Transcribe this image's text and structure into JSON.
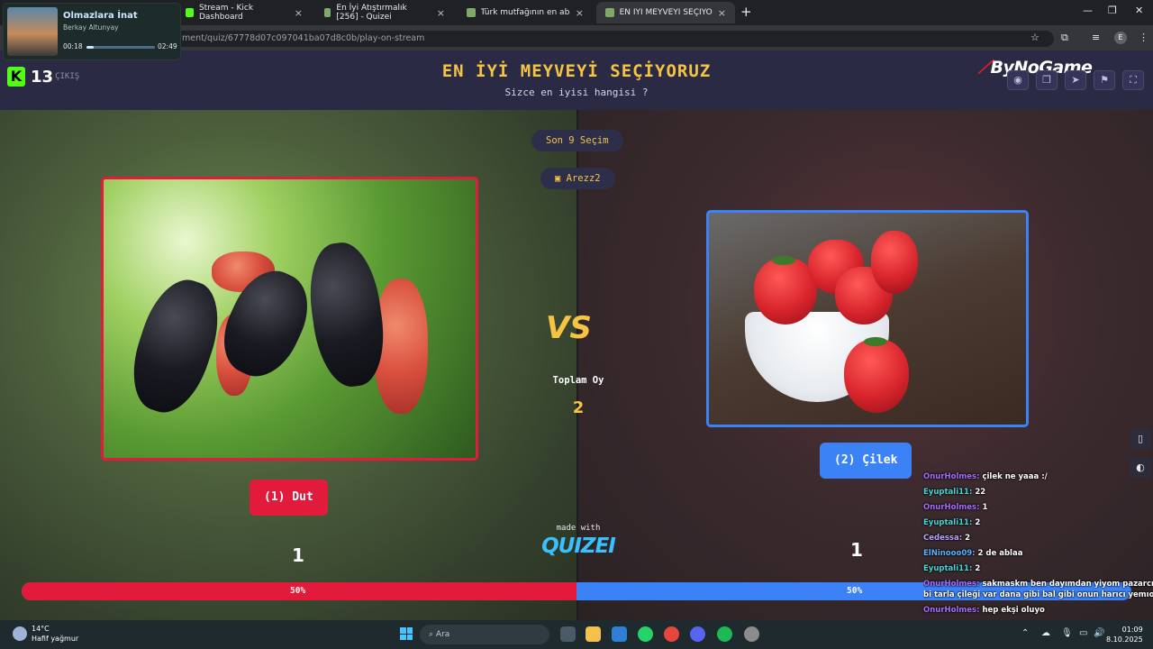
{
  "browser": {
    "tabs": [
      {
        "title": "Stream - Kick Dashboard"
      },
      {
        "title": "En İyi Atıştırmalık [256] - Quizei"
      },
      {
        "title": "Türk mutfağının en abartılmış t"
      },
      {
        "title": "EN İYİ MEYVEYİ SEÇİYORUZ - Q"
      }
    ],
    "url": "ment/quiz/67778d07c097041ba07d8c0b/play-on-stream",
    "profile_initial": "E"
  },
  "music": {
    "title": "Olmazlara İnat",
    "artist": "Berkay Altunyay",
    "elapsed": "00:18",
    "duration": "02:49",
    "progress": 0.1
  },
  "quiz": {
    "title": "EN İYİ MEYVEYİ SEÇİYORUZ",
    "subtitle": "Sizce en iyisi hangisi ?",
    "remaining": "Son 9 Seçim",
    "player": "Arezz2",
    "vs": "VS",
    "total_label": "Toplam Oy",
    "total_value": "2",
    "left": {
      "label": "(1) Dut",
      "votes": "1",
      "percent": "50%"
    },
    "right": {
      "label": "(2) Çilek",
      "votes": "1",
      "percent": "50%"
    },
    "progress_left_fraction": 0.5,
    "made_with": "made with",
    "quizei": "QUIZEI",
    "colors": {
      "left": "#e21b3c",
      "right": "#3b82f6",
      "accent": "#f5c542"
    }
  },
  "kick": {
    "logo": "K",
    "viewers": "13",
    "exit_label": "ÇIKIŞ"
  },
  "brand": {
    "logo": "ByNoGame"
  },
  "tools": [
    "eye-icon",
    "copy-icon",
    "send-icon",
    "flag-icon",
    "fullscreen-icon"
  ],
  "chat": [
    {
      "user": "OnurHolmes:",
      "text": "çilek ne yaaa :/",
      "color": "onur"
    },
    {
      "user": "Eyuptali11:",
      "text": "22",
      "color": "eyup"
    },
    {
      "user": "OnurHolmes:",
      "text": "1",
      "color": "onur"
    },
    {
      "user": "Eyuptali11:",
      "text": "2",
      "color": "eyup"
    },
    {
      "user": "Cedessa:",
      "text": "2",
      "color": "ced"
    },
    {
      "user": "ElNinooo09:",
      "text": "2 de ablaa",
      "color": "eli"
    },
    {
      "user": "Eyuptali11:",
      "text": "2",
      "color": "eyup"
    },
    {
      "user": "OnurHolmes:",
      "text": "sakmaskm ben dayımdan yiyom pazarcı dayım",
      "color": "onur"
    },
    {
      "user": "",
      "text": "bi tarla çileği var dana gibi bal gibi onun harıcı yemıom",
      "color": "onur"
    },
    {
      "user": "OnurHolmes:",
      "text": "hep ekşi oluyo",
      "color": "onur"
    },
    {
      "user": "Eyuptali11:",
      "text": "2",
      "color": "eyup"
    },
    {
      "user": "OnurHolmes:",
      "text": "1",
      "color": "onur"
    }
  ],
  "taskbar": {
    "temp": "14°C",
    "weather": "Hafif yağmur",
    "search": "Ara",
    "time": "01:09",
    "date": "8.10.2025"
  }
}
